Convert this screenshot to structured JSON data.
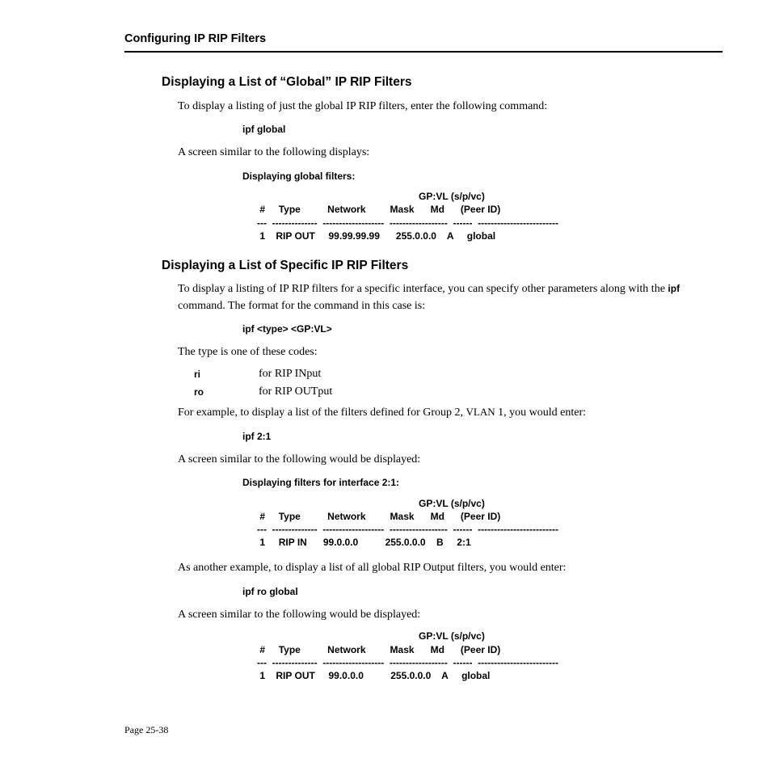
{
  "header": {
    "running": "Configuring IP RIP Filters"
  },
  "section1": {
    "title": "Displaying a List of “Global” IP RIP Filters",
    "p1": "To display a listing of just the global IP RIP filters, enter the following command:",
    "cmd": "ipf global",
    "p2": "A screen similar to the following displays:",
    "label": "Displaying global filters:",
    "table": {
      "h_peer1": "GP:VL (s/p/vc)",
      "h_num": "#",
      "h_type": "Type",
      "h_net": "Network",
      "h_mask": "Mask",
      "h_md": "Md",
      "h_peer2": "(Peer ID)",
      "sep": "---  --------------  -------------------  ------------------  ------  -------------------------",
      "r1_num": "1",
      "r1_type": "RIP OUT",
      "r1_net": "99.99.99.99",
      "r1_mask": "255.0.0.0",
      "r1_md": "A",
      "r1_peer": "global"
    }
  },
  "section2": {
    "title": "Displaying a List of Specific IP RIP Filters",
    "p1a": "To display a listing of IP RIP filters for a specific interface, you can specify other parameters along with the ",
    "p1b": "ipf",
    "p1c": " command. The format for the command in this case is:",
    "cmd1": "ipf <type> <GP:VL>",
    "p2": "The type is one of these codes:",
    "codes": [
      {
        "code": "ri",
        "desc": "for RIP INput"
      },
      {
        "code": "ro",
        "desc": "for RIP OUTput"
      }
    ],
    "p3a": "For example, to display a list of the filters defined for Group 2, ",
    "p3vlan": "VLAN",
    "p3b": " 1, you would enter:",
    "cmd2": "ipf 2:1",
    "p4": "A screen similar to the following would be displayed:",
    "label2": "Displaying filters for interface 2:1:",
    "table2": {
      "h_peer1": "GP:VL (s/p/vc)",
      "h_num": "#",
      "h_type": "Type",
      "h_net": "Network",
      "h_mask": "Mask",
      "h_md": "Md",
      "h_peer2": "(Peer ID)",
      "sep": "---  --------------  -------------------  ------------------  ------  -------------------------",
      "r1_num": "1",
      "r1_type": "RIP IN",
      "r1_net": "99.0.0.0",
      "r1_mask": "255.0.0.0",
      "r1_md": "B",
      "r1_peer": "2:1"
    },
    "p5": "As another example, to display a list of all global RIP Output filters, you would enter:",
    "cmd3": "ipf ro global",
    "p6": "A screen similar to the following would be displayed:",
    "table3": {
      "h_peer1": "GP:VL (s/p/vc)",
      "h_num": "#",
      "h_type": "Type",
      "h_net": "Network",
      "h_mask": "Mask",
      "h_md": "Md",
      "h_peer2": "(Peer ID)",
      "sep": "---  --------------  -------------------  ------------------  ------  -------------------------",
      "r1_num": "1",
      "r1_type": "RIP OUT",
      "r1_net": "99.0.0.0",
      "r1_mask": "255.0.0.0",
      "r1_md": "A",
      "r1_peer": "global"
    }
  },
  "page_number": "Page 25-38"
}
